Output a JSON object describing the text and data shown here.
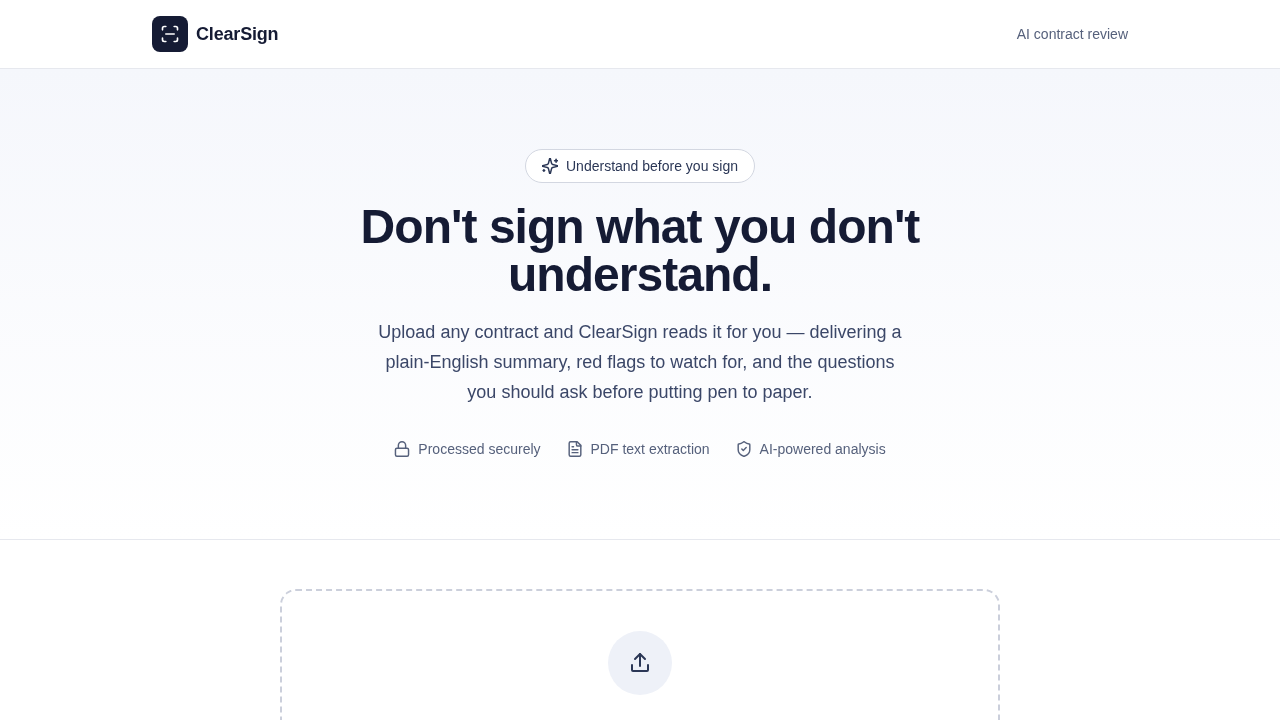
{
  "header": {
    "brand": "ClearSign",
    "tagline": "AI contract review"
  },
  "hero": {
    "badge": "Understand before you sign",
    "title": "Don't sign what you don't understand.",
    "description": "Upload any contract and ClearSign reads it for you — delivering a plain-English summary, red flags to watch for, and the questions you should ask before putting pen to paper.",
    "features": [
      {
        "kind": "lock",
        "label": "Processed securely"
      },
      {
        "kind": "document",
        "label": "PDF text extraction"
      },
      {
        "kind": "shield",
        "label": "AI-powered analysis"
      }
    ]
  }
}
